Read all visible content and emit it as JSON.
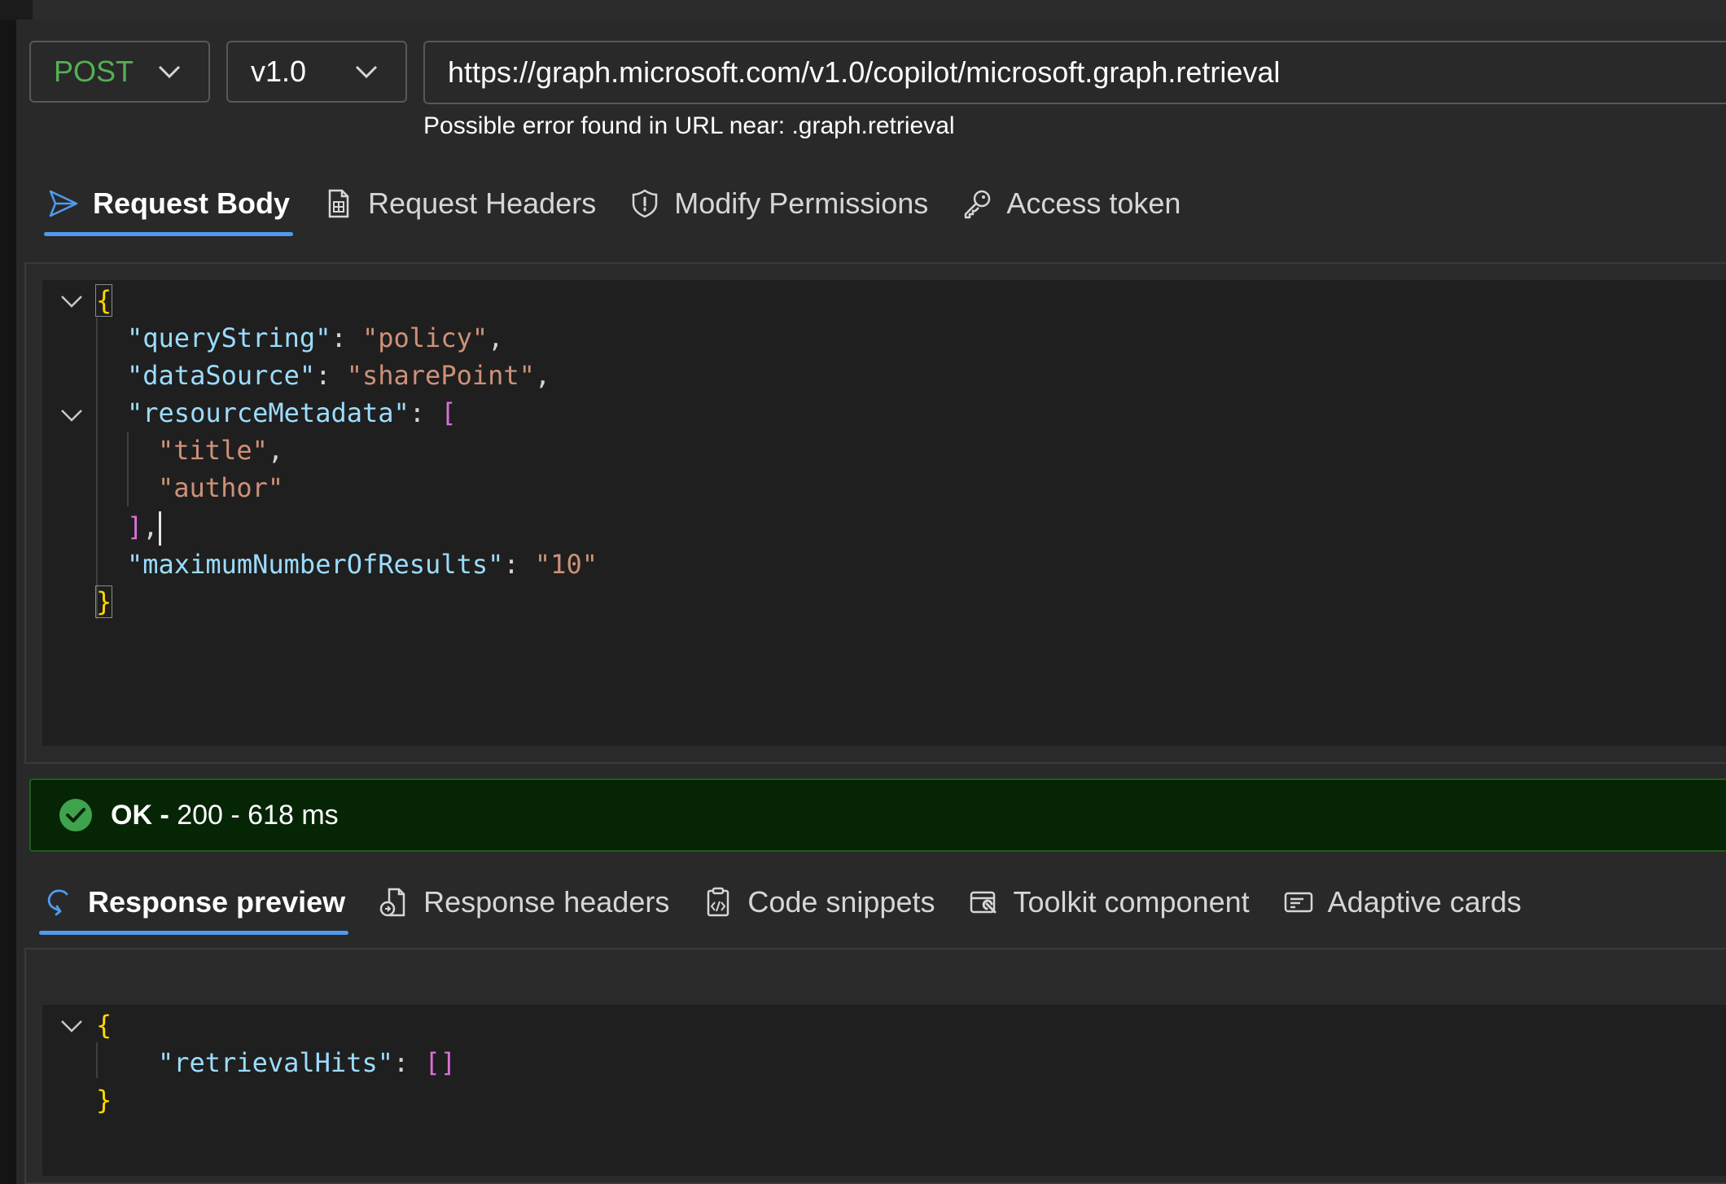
{
  "request": {
    "method": "POST",
    "version": "v1.0",
    "url": "https://graph.microsoft.com/v1.0/copilot/microsoft.graph.retrieval",
    "url_error": "Possible error found in URL near: .graph.retrieval"
  },
  "request_tabs": [
    {
      "label": "Request Body",
      "icon": "send-icon",
      "active": true
    },
    {
      "label": "Request Headers",
      "icon": "document-icon",
      "active": false
    },
    {
      "label": "Modify Permissions",
      "icon": "shield-icon",
      "active": false
    },
    {
      "label": "Access token",
      "icon": "key-icon",
      "active": false
    }
  ],
  "request_body": {
    "lines": [
      "{",
      "\"queryString\"",
      "\"policy\"",
      "\"dataSource\"",
      "\"sharePoint\"",
      "\"resourceMetadata\"",
      "\"title\"",
      "\"author\"",
      "\"maximumNumberOfResults\"",
      "\"10\"",
      "}"
    ]
  },
  "status": {
    "ok_label": "OK -",
    "detail": "200 - 618 ms",
    "color": "#052505"
  },
  "response_tabs": [
    {
      "label": "Response preview",
      "icon": "response-icon",
      "active": true
    },
    {
      "label": "Response headers",
      "icon": "response-headers-icon",
      "active": false
    },
    {
      "label": "Code snippets",
      "icon": "code-snippet-icon",
      "active": false
    },
    {
      "label": "Toolkit component",
      "icon": "toolkit-icon",
      "active": false
    },
    {
      "label": "Adaptive cards",
      "icon": "card-icon",
      "active": false
    }
  ],
  "response_body": {
    "key": "\"retrievalHits\""
  },
  "colors": {
    "accent": "#4f9bf0",
    "method_post": "#54b054",
    "json_key": "#9cdcfe",
    "json_string": "#ce9178",
    "brace": "#ffd700",
    "bracket": "#da70d6"
  }
}
